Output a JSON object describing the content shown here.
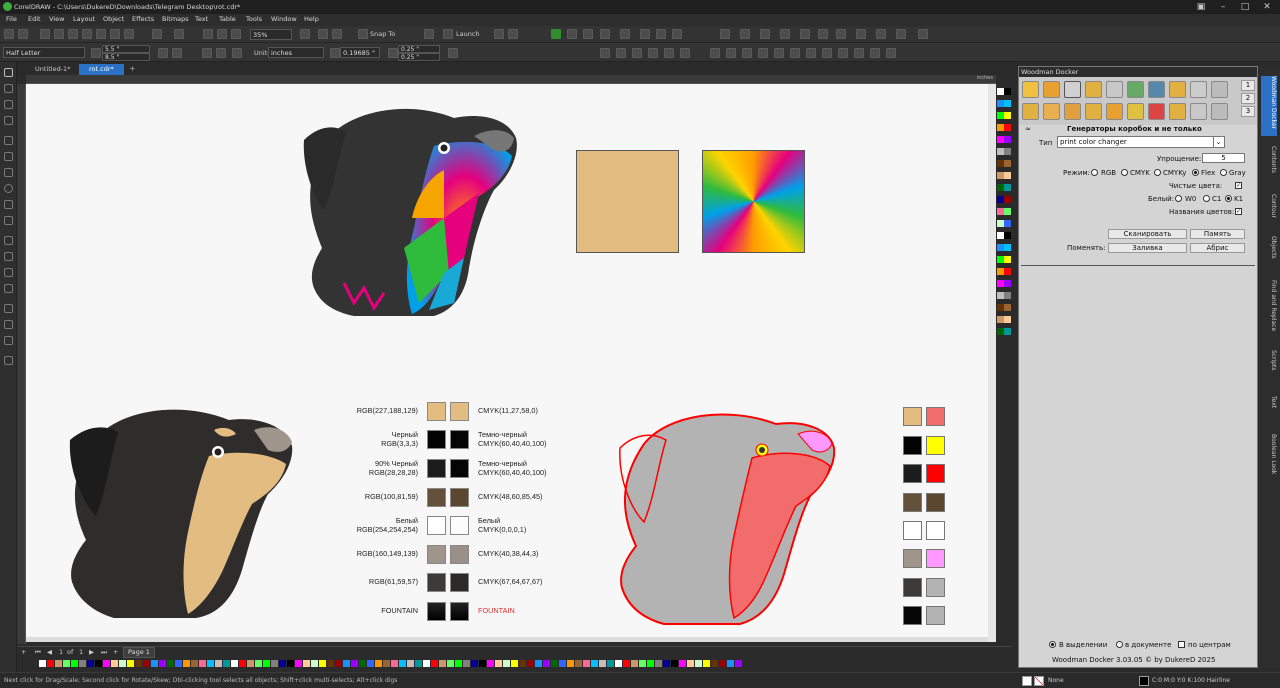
{
  "window": {
    "title": "CorelDRAW - C:\\Users\\DukereD\\Downloads\\Telegram Desktop\\rot.cdr*"
  },
  "menu": [
    "File",
    "Edit",
    "View",
    "Layout",
    "Object",
    "Effects",
    "Bitmaps",
    "Text",
    "Table",
    "Tools",
    "Window",
    "Help"
  ],
  "toolbar": {
    "zoom": "35%",
    "snap_label": "Snap To",
    "launch_label": "Launch"
  },
  "propertybar": {
    "page_size": "Half Letter",
    "width": "5.5 \"",
    "height": "8.5 \"",
    "units_label": "Units:",
    "units_value": "inches",
    "nudge": "0.19685 \"",
    "dup_x": "0.25 \"",
    "dup_y": "0.25 \""
  },
  "tabs": [
    {
      "label": "Untitled-1*"
    },
    {
      "label": "rot.cdr*"
    }
  ],
  "ruler_unit": "inches",
  "palette_colors": {
    "beige": "#e3bc82",
    "black": "#030303",
    "dark": "#1c1c1c",
    "brown": "#64513b",
    "white": "#fefefe",
    "gray": "#a0958b",
    "charcoal": "#3d3b39",
    "red": "#f26c6c",
    "yellow": "#ffff00",
    "pure_red": "#ff0000",
    "pink": "#ff99ff",
    "mid_gray": "#b3b3b3"
  },
  "swatch_rows": [
    {
      "left": "RGB(227,188,129)",
      "right": "CMYK(11,27,58,0)"
    },
    {
      "left": "Черный\nRGB(3,3,3)",
      "right": "Темно-черный\nCMYK(60,40,40,100)"
    },
    {
      "left": "90% Черный\nRGB(28,28,28)",
      "right": "Темно-черный\nCMYK(60,40,40,100)"
    },
    {
      "left": "RGB(100,81,59)",
      "right": "CMYK(48,60,85,45)"
    },
    {
      "left": "Белый\nRGB(254,254,254)",
      "right": "Белый\nCMYK(0,0,0,1)"
    },
    {
      "left": "RGB(160,149,139)",
      "right": "CMYK(40,38,44,3)"
    },
    {
      "left": "RGB(61,59,57)",
      "right": "CMYK(67,64,67,67)"
    },
    {
      "left": "FOUNTAIN",
      "right": "FOUNTAIN"
    }
  ],
  "page": {
    "current": "1",
    "of": "of",
    "total": "1",
    "tab": "Page 1"
  },
  "status": {
    "hint": "Next click for Drag/Scale; Second click for Rotate/Skew; Dbl-clicking tool selects all objects; Shift+click multi-selects; Alt+click digs",
    "fill": "None",
    "outline": "C:0 M:0 Y:0 K:100  Hairline"
  },
  "docker": {
    "title": "Woodman Docker",
    "pages": [
      "1",
      "2",
      "3"
    ],
    "section_title": "Генераторы коробок и не только",
    "type_label": "Тип",
    "type_value": "print color changer",
    "simplify_label": "Упрощение:",
    "simplify_value": "5",
    "mode_label": "Режим:",
    "modes": [
      "RGB",
      "CMYK",
      "CMYKy",
      "Flex",
      "Gray"
    ],
    "mode_selected": "Flex",
    "clean_label": "Чистые цвета:",
    "white_label": "Белый:",
    "white_opts": [
      "W0",
      "C1",
      "K1"
    ],
    "names_label": "Названия цветов:",
    "scan_btn": "Сканировать",
    "memory_btn": "Память",
    "change_label": "Поменять:",
    "fill_btn": "Заливка",
    "outline_btn": "Абрис",
    "scope": [
      "В выделении",
      "в документе",
      "по центрам"
    ],
    "footer": "Woodman Docker 3.03.05 © by DukereD 2025"
  },
  "side_tabs": [
    "Woodman Docker",
    "Contents",
    "Contour",
    "Objects",
    "Find and Replace",
    "Scripts",
    "Text",
    "Boolean Lookups"
  ]
}
